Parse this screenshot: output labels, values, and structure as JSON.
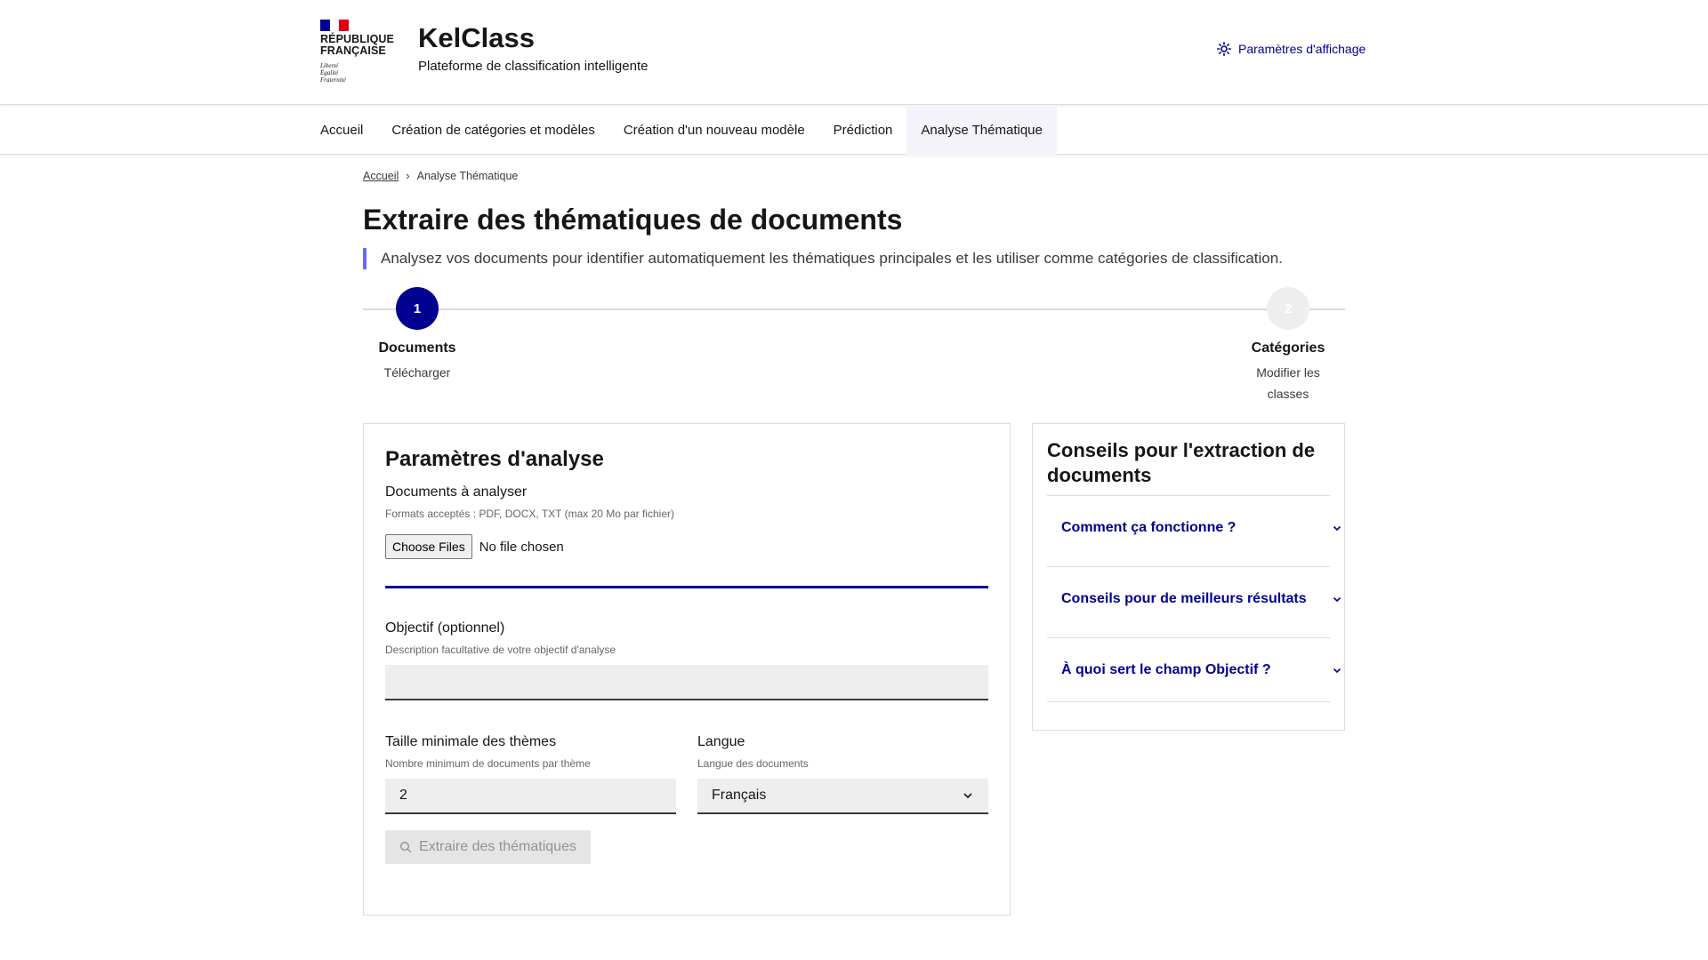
{
  "header": {
    "gov_line1": "République",
    "gov_line2": "Française",
    "motto1": "Liberté",
    "motto2": "Égalité",
    "motto3": "Fraternité",
    "brand_title": "KelClass",
    "brand_tagline": "Plateforme de classification intelligente",
    "display_settings": "Paramètres d'affichage"
  },
  "nav": {
    "items": [
      {
        "label": "Accueil"
      },
      {
        "label": "Création de catégories et modèles"
      },
      {
        "label": "Création d'un nouveau modèle"
      },
      {
        "label": "Prédiction"
      },
      {
        "label": "Analyse Thématique"
      }
    ],
    "active_index": 4
  },
  "breadcrumb": {
    "home": "Accueil",
    "current": "Analyse Thématique"
  },
  "page": {
    "title": "Extraire des thématiques de documents",
    "lead": "Analysez vos documents pour identifier automatiquement les thématiques principales et les utiliser comme catégories de classification."
  },
  "stepper": {
    "steps": [
      {
        "number": "1",
        "title": "Documents",
        "desc": "Télécharger",
        "state": "active"
      },
      {
        "number": "2",
        "title": "Catégories",
        "desc": "Modifier les classes",
        "state": "inactive"
      }
    ]
  },
  "form": {
    "title": "Paramètres d'analyse",
    "docs_label": "Documents à analyser",
    "docs_hint": "Formats acceptés : PDF, DOCX, TXT (max 20 Mo par fichier)",
    "file_button": "Choose Files",
    "file_status": "No file chosen",
    "objective_label": "Objectif (optionnel)",
    "objective_hint": "Description facultative de votre objectif d'analyse",
    "objective_value": "",
    "min_size_label": "Taille minimale des thèmes",
    "min_size_hint": "Nombre minimum de documents par thème",
    "min_size_value": "2",
    "lang_label": "Langue",
    "lang_hint": "Langue des documents",
    "lang_value": "Français",
    "submit_label": "Extraire des thématiques"
  },
  "tips": {
    "title": "Conseils pour l'extraction de documents",
    "items": [
      {
        "label": "Comment ça fonctionne ?"
      },
      {
        "label": "Conseils pour de meilleurs résultats"
      },
      {
        "label": "À quoi sert le champ Objectif ?"
      }
    ]
  },
  "colors": {
    "primary_blue": "#000091",
    "accent": "#6a6af4",
    "flag_red": "#e1000f"
  }
}
